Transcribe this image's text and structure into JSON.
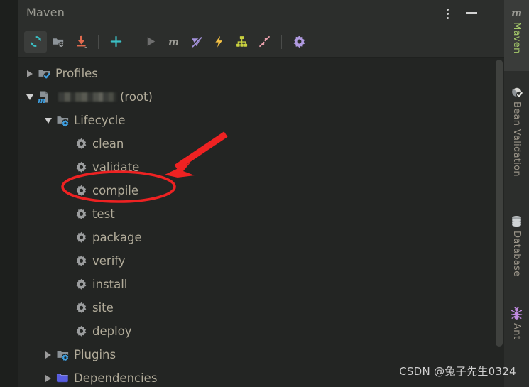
{
  "window": {
    "title": "Maven",
    "menu_icon": "kebab-vertical-icon",
    "minimize_icon": "minimize-icon"
  },
  "toolbar": {
    "buttons": [
      {
        "name": "reload-project-button",
        "icon": "refresh-icon",
        "label": "Reload All Maven Projects",
        "selected": true
      },
      {
        "name": "add-maven-project-button",
        "icon": "folder-sync-icon",
        "label": "Add Maven Projects",
        "selected": false
      },
      {
        "name": "download-sources-button",
        "icon": "download-arrow-icon",
        "label": "Download Sources and/or Documentation",
        "selected": false
      },
      {
        "name": "separator-1",
        "icon": "separator",
        "label": "",
        "selected": false
      },
      {
        "name": "add-goal-button",
        "icon": "plus-icon",
        "label": "Add Maven Goal",
        "selected": false
      },
      {
        "name": "separator-2",
        "icon": "separator",
        "label": "",
        "selected": false
      },
      {
        "name": "run-button",
        "icon": "play-triangle-icon",
        "label": "Run",
        "selected": false
      },
      {
        "name": "execute-maven-goal-button",
        "icon": "maven-m-icon",
        "label": "Execute Maven Goal",
        "selected": false
      },
      {
        "name": "toggle-offline-button",
        "icon": "offline-mode-icon",
        "label": "Toggle Offline Mode",
        "selected": false
      },
      {
        "name": "skip-tests-button",
        "icon": "lightning-bolt-icon",
        "label": "Skip Tests",
        "selected": false
      },
      {
        "name": "show-dependencies-button",
        "icon": "dependency-tree-icon",
        "label": "Show Dependencies",
        "selected": false
      },
      {
        "name": "collapse-all-button",
        "icon": "collapse-arrows-icon",
        "label": "Collapse All",
        "selected": false
      },
      {
        "name": "separator-3",
        "icon": "separator",
        "label": "",
        "selected": false
      },
      {
        "name": "maven-settings-button",
        "icon": "gear-icon",
        "label": "Maven Settings",
        "selected": false
      }
    ]
  },
  "tree": {
    "nodes": [
      {
        "name": "tree-node-profiles",
        "label": "Profiles",
        "icon": "folder-check-icon",
        "twisty": "right",
        "depth": 0,
        "censored": false
      },
      {
        "name": "tree-node-root-project",
        "label": "(root)",
        "icon": "maven-module-icon",
        "twisty": "down",
        "depth": 0,
        "censored": true
      },
      {
        "name": "tree-node-lifecycle",
        "label": "Lifecycle",
        "icon": "folder-gear-icon",
        "twisty": "down",
        "depth": 1,
        "censored": false
      },
      {
        "name": "tree-node-clean",
        "label": "clean",
        "icon": "gear-icon",
        "twisty": "none",
        "depth": 2,
        "censored": false
      },
      {
        "name": "tree-node-validate",
        "label": "validate",
        "icon": "gear-icon",
        "twisty": "none",
        "depth": 2,
        "censored": false
      },
      {
        "name": "tree-node-compile",
        "label": "compile",
        "icon": "gear-icon",
        "twisty": "none",
        "depth": 2,
        "censored": false
      },
      {
        "name": "tree-node-test",
        "label": "test",
        "icon": "gear-icon",
        "twisty": "none",
        "depth": 2,
        "censored": false
      },
      {
        "name": "tree-node-package",
        "label": "package",
        "icon": "gear-icon",
        "twisty": "none",
        "depth": 2,
        "censored": false
      },
      {
        "name": "tree-node-verify",
        "label": "verify",
        "icon": "gear-icon",
        "twisty": "none",
        "depth": 2,
        "censored": false
      },
      {
        "name": "tree-node-install",
        "label": "install",
        "icon": "gear-icon",
        "twisty": "none",
        "depth": 2,
        "censored": false
      },
      {
        "name": "tree-node-site",
        "label": "site",
        "icon": "gear-icon",
        "twisty": "none",
        "depth": 2,
        "censored": false
      },
      {
        "name": "tree-node-deploy",
        "label": "deploy",
        "icon": "gear-icon",
        "twisty": "none",
        "depth": 2,
        "censored": false
      },
      {
        "name": "tree-node-plugins",
        "label": "Plugins",
        "icon": "folder-gear-icon",
        "twisty": "right",
        "depth": 1,
        "censored": false
      },
      {
        "name": "tree-node-dependencies",
        "label": "Dependencies",
        "icon": "folder-blue-icon",
        "twisty": "right",
        "depth": 1,
        "censored": false
      }
    ]
  },
  "right_tabs": [
    {
      "name": "tool-tab-maven",
      "label": "Maven",
      "icon": "maven-m-icon",
      "active": true
    },
    {
      "name": "tool-tab-bean-validation",
      "label": "Bean Validation",
      "icon": "bean-check-icon",
      "active": false
    },
    {
      "name": "tool-tab-database",
      "label": "Database",
      "icon": "database-icon",
      "active": false
    },
    {
      "name": "tool-tab-ant",
      "label": "Ant",
      "icon": "ant-bug-icon",
      "active": false
    }
  ],
  "annotations": {
    "highlight_color": "#ee2222",
    "ellipse_target": "compile",
    "arrow_name": "red-arrow-annotation",
    "ellipse_name": "red-ellipse-annotation"
  },
  "watermark": {
    "text": "CSDN @兔子先生0324"
  },
  "colors": {
    "window_bg": "#232523",
    "header_bg": "#2c2e2c",
    "text": "#b2ac9a",
    "accent_green": "#a4c96a",
    "accent_cyan": "#3bbfc4",
    "accent_purple": "#b09ae0",
    "accent_red": "#ee2222"
  }
}
